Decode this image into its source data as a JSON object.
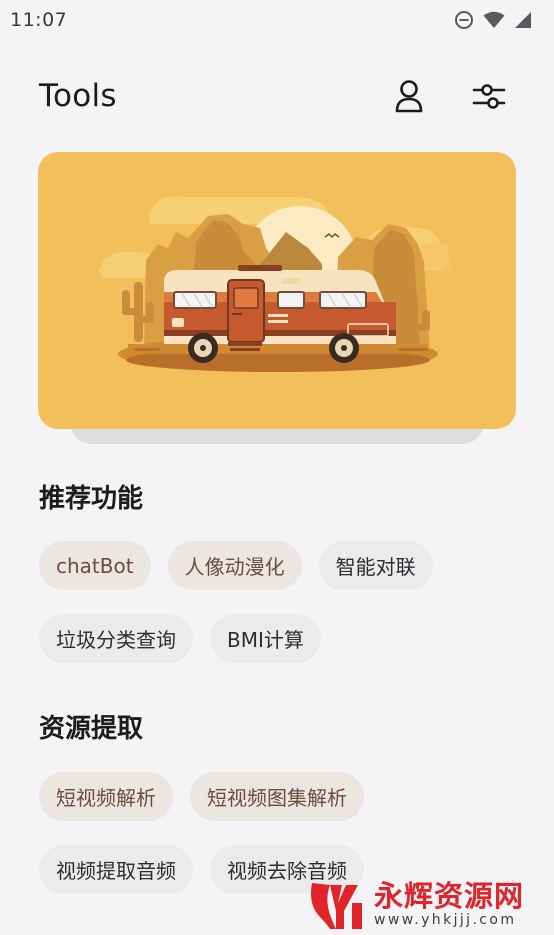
{
  "status_bar": {
    "time": "11:07",
    "icons": [
      "do-not-disturb-icon",
      "wifi-icon",
      "cellular-signal-icon"
    ]
  },
  "header": {
    "title": "Tools",
    "actions": [
      "profile-icon",
      "settings-sliders-icon"
    ]
  },
  "banner": {
    "image": "camper-van-desert-illustration",
    "background_color": "#f2bf5a"
  },
  "sections": {
    "recommended": {
      "title": "推荐功能",
      "items": [
        {
          "label": "chatBot",
          "style": "accent"
        },
        {
          "label": "人像动漫化",
          "style": "accent"
        },
        {
          "label": "智能对联",
          "style": "plain"
        },
        {
          "label": "垃圾分类查询",
          "style": "plain"
        },
        {
          "label": "BMI计算",
          "style": "plain"
        }
      ]
    },
    "resources": {
      "title": "资源提取",
      "items": [
        {
          "label": "短视频解析",
          "style": "accent"
        },
        {
          "label": "短视频图集解析",
          "style": "accent"
        },
        {
          "label": "视频提取音频",
          "style": "plain"
        },
        {
          "label": "视频去除音频",
          "style": "plain"
        }
      ]
    }
  },
  "watermark": {
    "title": "永辉资源网",
    "url": "www.yhkjjj.com"
  },
  "colors": {
    "background": "#f4f4f6",
    "chip_accent_bg": "#ece6e3",
    "chip_accent_text": "#6b4d40",
    "chip_plain_bg": "#ebebed",
    "watermark_red": "#e0242a"
  }
}
